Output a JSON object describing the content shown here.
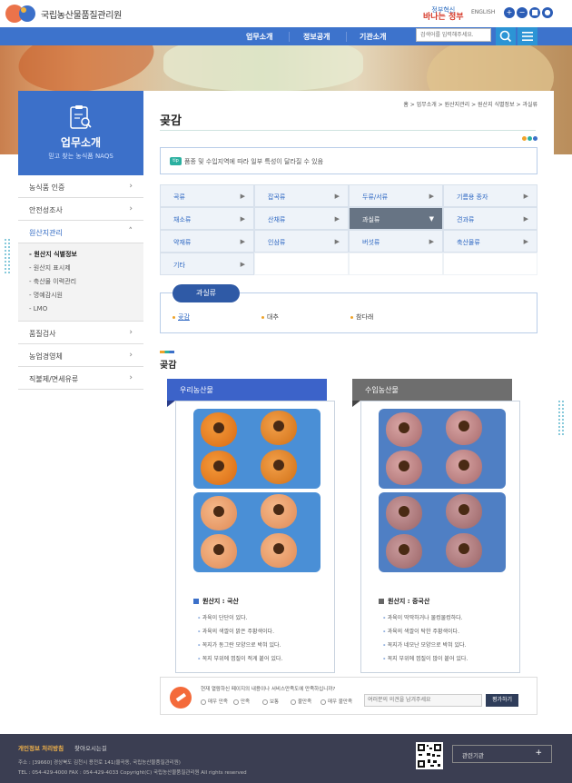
{
  "header": {
    "logo_text": "국립농산물품질관리원",
    "slogan_top": "정부혁신",
    "slogan_big": "바나는 정부",
    "english_label": "ENGLISH",
    "zoom_buttons": [
      "+",
      "−",
      "■",
      "●"
    ],
    "nav": [
      "업무소개",
      "정보공개",
      "기관소개"
    ],
    "search_placeholder": "검색어를 입력해주세요."
  },
  "sidebar": {
    "title": "업무소개",
    "subtitle": "믿고 찾는 농식품 NAQS",
    "items_top": [
      {
        "label": "농식품 인증",
        "arrow": "›"
      },
      {
        "label": "안전성조사",
        "arrow": "›"
      },
      {
        "label": "원산지관리",
        "arrow": "˄"
      }
    ],
    "sub_items": [
      "원산지 식별정보",
      "원산지 표시제",
      "축산물 이력관리",
      "명예감시원",
      "LMO"
    ],
    "items_bottom": [
      {
        "label": "품질검사",
        "arrow": "›"
      },
      {
        "label": "농업경영체",
        "arrow": "›"
      },
      {
        "label": "직불제/면세유류",
        "arrow": "›"
      }
    ]
  },
  "content": {
    "breadcrumb": "홈 > 업무소개 > 원산지관리 > 원산지 식별정보 > 과실류",
    "page_title": "곶감",
    "tip_badge": "tip",
    "tip_text": "품종 및 수입지역에 따라 일부 특성이 달라질 수 있음",
    "categories": [
      "곡류",
      "잡곡류",
      "두류/서류",
      "기름용 종자",
      "채소류",
      "산채류",
      "과실류",
      "견과류",
      "약재류",
      "인삼류",
      "버섯류",
      "축산물류",
      "기타"
    ],
    "active_category": "과실류",
    "sub_title": "과실류",
    "sub_options": [
      "곶감",
      "대추",
      "참다래"
    ],
    "section_title": "곶감",
    "domestic": {
      "tab": "우리농산물",
      "origin": "원산지 : 국산",
      "bullets": [
        "과육이 단단이 있다.",
        "과육의 색깔이 밝은 주황색이다.",
        "꼭지가 동그란 모양으로 박혀 있다.",
        "꼭지 부위에 껍질이 적게 붙어 있다."
      ]
    },
    "imported": {
      "tab": "수입농산물",
      "origin": "원산지 : 중국산",
      "bullets": [
        "과육이 딱딱하거나 물컹물컹하다.",
        "과육의 색깔이 탁한 주황색이다.",
        "꼭지가 네모난 모양으로 박혀 있다.",
        "꼭지 부위에 껍질이 많이 붙어 있다."
      ]
    },
    "survey": {
      "question": "현재 열람하신 페이지의 내용이나 서비스만족도에 만족하십니까?",
      "options": [
        "매우 만족",
        "만족",
        "보통",
        "불만족",
        "매우 불만족"
      ],
      "placeholder": "여러분의 의견을 남겨주세요",
      "button": "평가하기"
    }
  },
  "footer": {
    "privacy": "개인정보 처리방침",
    "directions": "찾아오시는길",
    "address": "주소 : [39660] 경상북도 김천시 용전로 141(율곡동, 국립농산물품질관리원)",
    "tel": "TEL : 054-429-4000     FAX : 054-429-4033     Copyright(C) 국립농산물품질관리원 All rights reserved",
    "related": "관련기관",
    "related_plus": "+"
  },
  "colors": {
    "primary": "#3d73cc",
    "sidebar": "#3c70c9",
    "accent": "#2c94d5",
    "footer": "#3b3e52"
  }
}
